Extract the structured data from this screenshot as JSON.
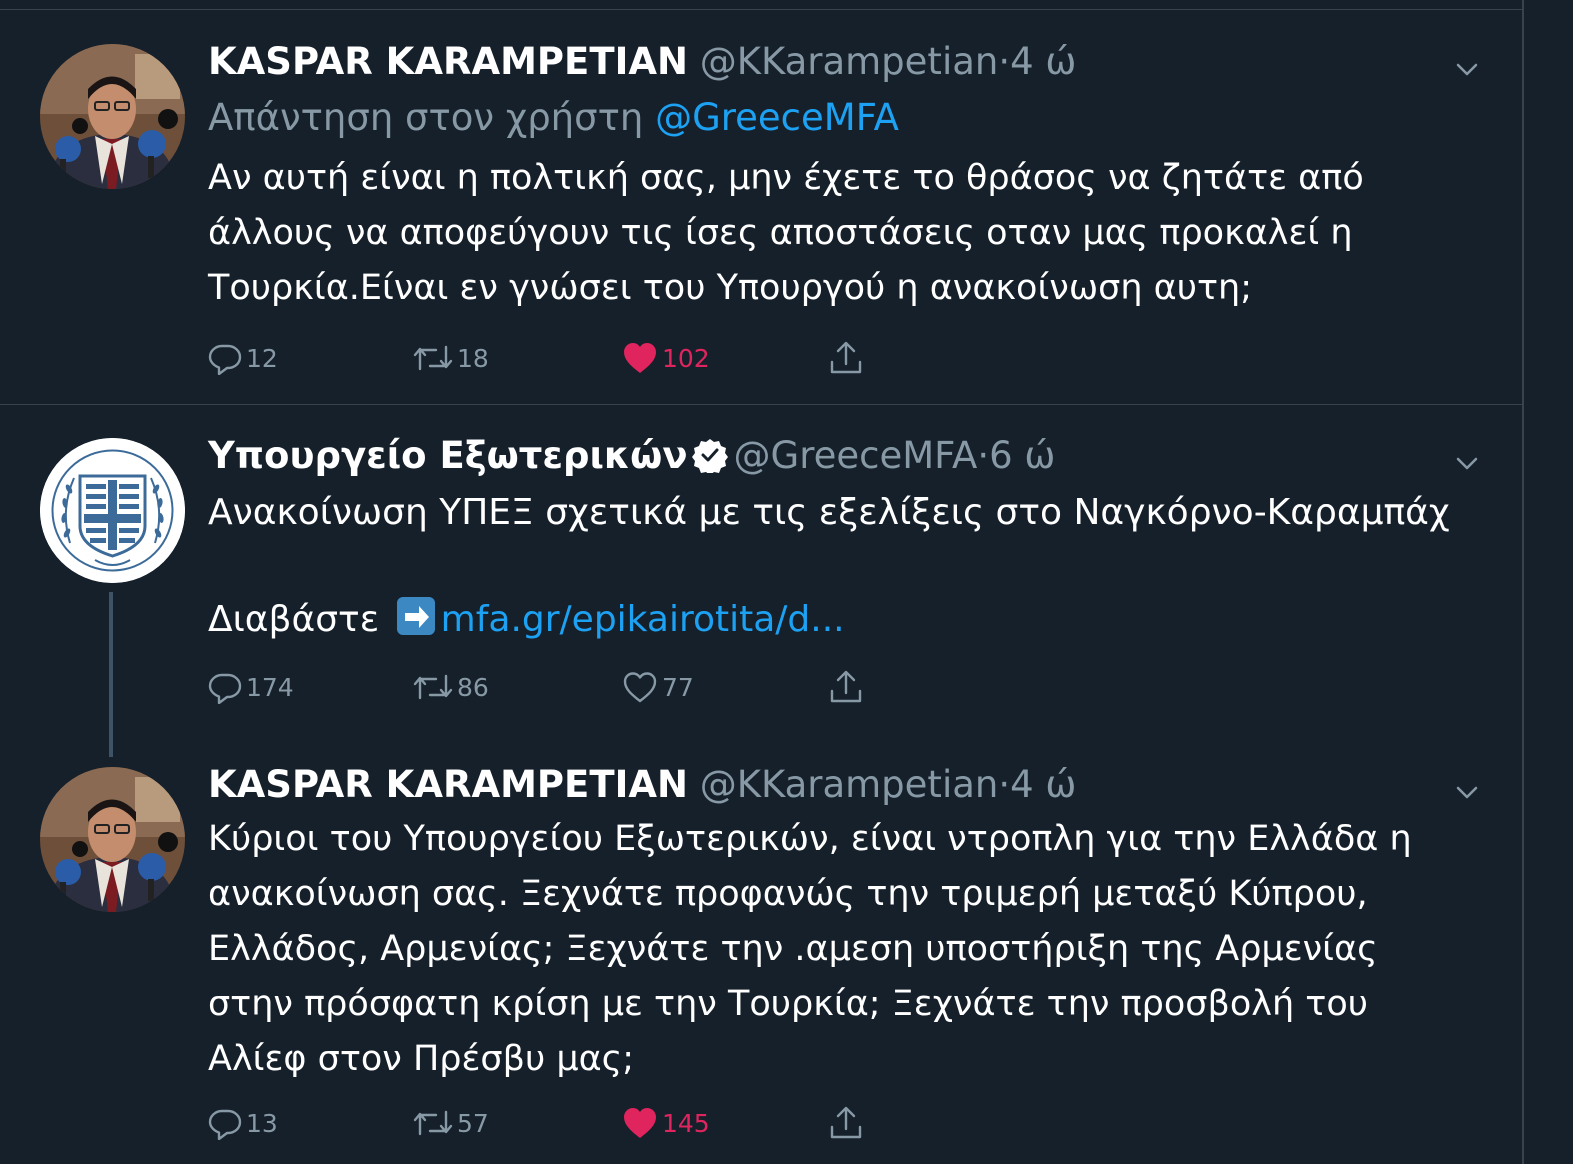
{
  "tweets": [
    {
      "name": "KASPAR KARAMPETIAN",
      "handle": "@KKarampetian",
      "separator": "·",
      "time": "4 ώ",
      "reply_prefix": "Απάντηση στον χρήστη",
      "reply_mention": "@GreeceMFA",
      "text": "Αν αυτή είναι η πολτική σας, μην έχετε το θράσος να ζητάτε από άλλους να αποφεύγουν τις ίσες αποστάσεις οταν μας προκαλεί η Τουρκία.Είναι εν γνώσει του Υπουργού η ανακοίνωση αυτη;",
      "replies": "12",
      "retweets": "18",
      "likes": "102",
      "liked": true
    },
    {
      "name": "Υπουργείο Εξωτερικών",
      "verified": true,
      "handle": "@GreeceMFA",
      "separator": "·",
      "time": "6 ώ",
      "text": "Ανακοίνωση ΥΠΕΞ σχετικά με τις εξελίξεις στο Ναγκόρνο-Καραμπάχ",
      "read_label": "Διαβάστε",
      "link_text": "mfa.gr/epikairotita/d...",
      "replies": "174",
      "retweets": "86",
      "likes": "77",
      "liked": false
    },
    {
      "name": "KASPAR KARAMPETIAN",
      "handle": "@KKarampetian",
      "separator": "·",
      "time": "4 ώ",
      "text": "Κύριοι του Υπουργείου Εξωτερικών, είναι ντροπλη για την Ελλάδα η ανακοίνωση σας. Ξεχνάτε προφανώς την τριμερή μεταξύ Κύπρου, Ελλάδος, Αρμενίας; Ξεχνάτε την .αμεση υποστήριξη της Αρμενίας στην πρόσφατη κρίση με την Τουρκία; Ξεχνάτε την προσβολή του Αλίεφ στον Πρέσβυ μας;",
      "replies": "13",
      "retweets": "57",
      "likes": "145",
      "liked": true
    }
  ],
  "colors": {
    "background": "#15202b",
    "border": "#38444d",
    "secondary_text": "#8899a6",
    "accent": "#1da1f2",
    "like": "#e0245e"
  },
  "icons": {
    "reply": "speech-bubble-icon",
    "retweet": "retweet-icon",
    "like": "heart-icon",
    "share": "share-icon",
    "more": "chevron-down-icon",
    "verified": "verified-badge-icon",
    "arrow": "right-arrow-emoji"
  }
}
